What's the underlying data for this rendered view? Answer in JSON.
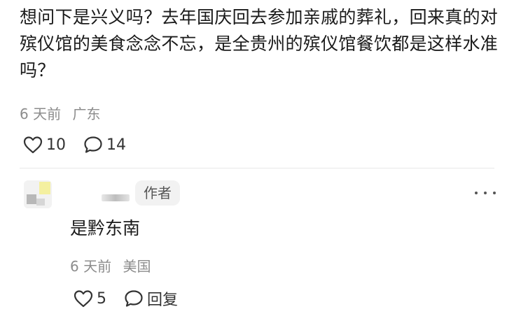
{
  "main_comment": {
    "text": "想问下是兴义吗？去年国庆回去参加亲戚的葬礼，回来真的对殡仪馆的美食念念不忘，是全贵州的殡仪馆餐饮都是这样水准吗？",
    "time": "6 天前",
    "location": "广东",
    "like_count": "10",
    "comment_count": "14",
    "like_icon": "heart-outline-icon",
    "comment_icon": "speech-bubble-icon"
  },
  "reply": {
    "badge": "作者",
    "text": "是黔东南",
    "time": "6 天前",
    "location": "美国",
    "like_count": "5",
    "reply_label": "回复",
    "more_icon": "more-dots-icon"
  },
  "colors": {
    "text": "#1a1a1a",
    "meta": "#8c8c8c",
    "badge_bg": "#f2f2f2"
  }
}
